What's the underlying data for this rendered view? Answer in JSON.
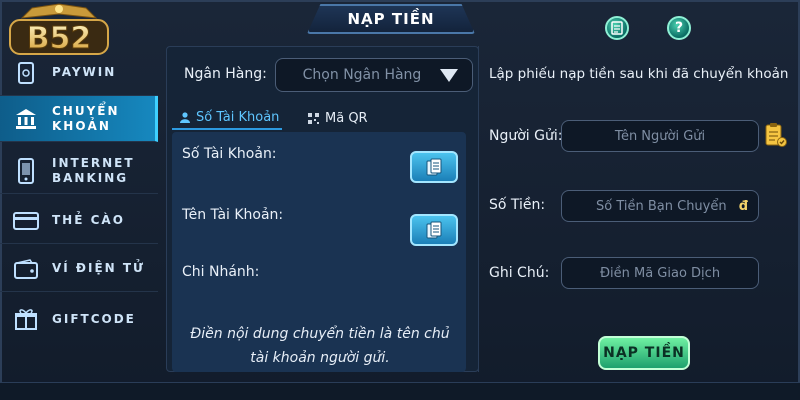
{
  "header": {
    "title": "NẠP TIỀN"
  },
  "logo": {
    "text": "B52"
  },
  "sidebar": {
    "items": [
      {
        "label": "PAYWIN",
        "icon": "paywin-icon"
      },
      {
        "label": "CHUYỂN KHOẢN",
        "icon": "bank-icon",
        "active": true
      },
      {
        "label": "INTERNET BANKING",
        "icon": "phone-icon"
      },
      {
        "label": "THẺ CÀO",
        "icon": "card-icon"
      },
      {
        "label": "VÍ ĐIỆN TỬ",
        "icon": "wallet-icon"
      },
      {
        "label": "GIFTCODE",
        "icon": "gift-icon"
      }
    ]
  },
  "bank": {
    "label": "Ngân Hàng:",
    "placeholder": "Chọn Ngân Hàng"
  },
  "tabs": {
    "account": "Số Tài Khoản",
    "qr": "Mã QR"
  },
  "account_info": {
    "number_label": "Số Tài Khoản:",
    "name_label": "Tên Tài Khoản:",
    "branch_label": "Chi Nhánh:",
    "note": "Điền nội dung chuyển tiền là tên chủ tài khoản người gửi."
  },
  "form": {
    "intro": "Lập phiếu nạp tiền sau khi đã chuyển khoản",
    "sender_label": "Người Gửi:",
    "sender_placeholder": "Tên Người Gửi",
    "amount_label": "Số Tiền:",
    "amount_placeholder": "Số Tiền Bạn Chuyển",
    "currency": "đ",
    "note_label": "Ghi Chú:",
    "note_placeholder": "Điền Mã Giao Dịch",
    "submit_label": "NẠP TIỀN"
  },
  "colors": {
    "accent": "#1688bf",
    "submit": "#1da06d"
  }
}
